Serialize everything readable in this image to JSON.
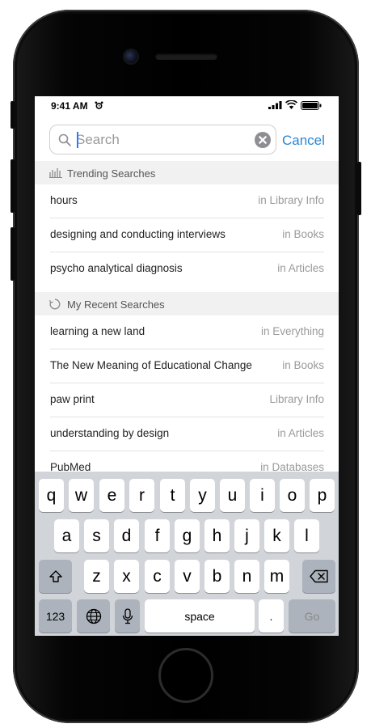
{
  "status_bar": {
    "time": "9:41 AM"
  },
  "search": {
    "placeholder": "Search",
    "value": "",
    "cancel_label": "Cancel"
  },
  "trending": {
    "title": "Trending Searches",
    "items": [
      {
        "term": "hours",
        "scope": "in Library Info"
      },
      {
        "term": "designing and conducting interviews",
        "scope": "in Books"
      },
      {
        "term": "psycho analytical diagnosis",
        "scope": "in Articles"
      }
    ]
  },
  "recent": {
    "title": "My Recent Searches",
    "items": [
      {
        "term": "learning a new land",
        "scope": "in Everything"
      },
      {
        "term": "The New Meaning of Educational Change",
        "scope": "in Books"
      },
      {
        "term": "paw print",
        "scope": "Library Info"
      },
      {
        "term": "understanding by design",
        "scope": "in Articles"
      },
      {
        "term": "PubMed",
        "scope": "in Databases"
      }
    ]
  },
  "keyboard": {
    "row1": [
      "q",
      "w",
      "e",
      "r",
      "t",
      "y",
      "u",
      "i",
      "o",
      "p"
    ],
    "row2": [
      "a",
      "s",
      "d",
      "f",
      "g",
      "h",
      "j",
      "k",
      "l"
    ],
    "row3": [
      "z",
      "x",
      "c",
      "v",
      "b",
      "n",
      "m"
    ],
    "numbers_label": "123",
    "space_label": "space",
    "period_label": ".",
    "go_label": "Go",
    "icons": {
      "shift": "shift-icon",
      "backspace": "backspace-icon",
      "globe": "globe-icon",
      "mic": "microphone-icon"
    }
  },
  "colors": {
    "accent": "#2a86d2",
    "caret": "#3478f6",
    "section_bg": "#f1f1f1",
    "keyboard_bg": "#d1d4d9",
    "special_key": "#adb3bc"
  }
}
